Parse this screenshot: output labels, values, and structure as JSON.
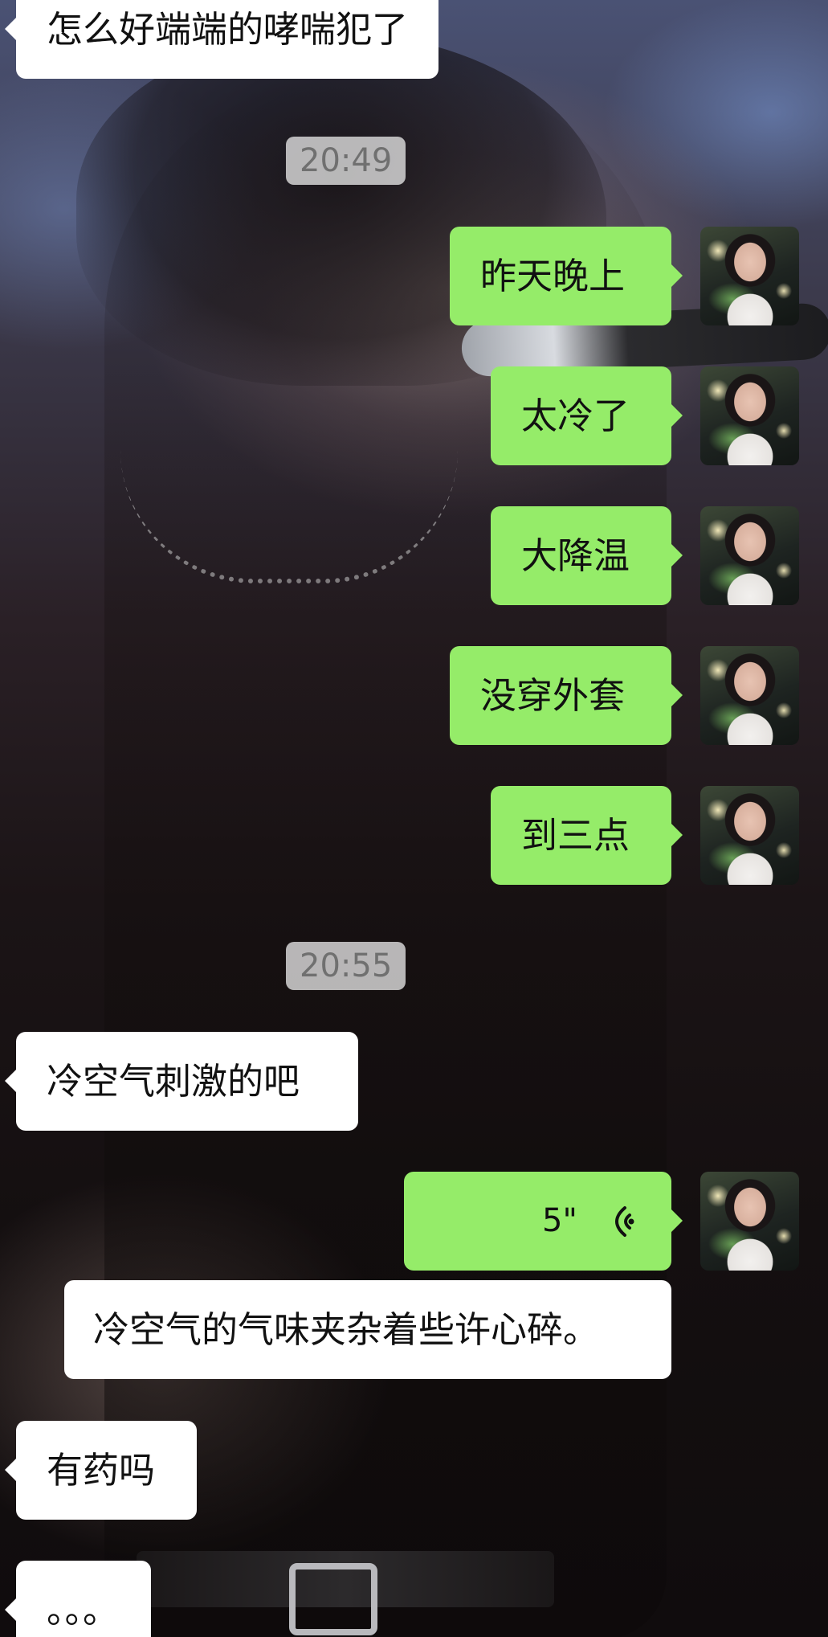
{
  "chat": {
    "timestamps": {
      "first": "20:49",
      "second": "20:55"
    },
    "messages": {
      "m1": "怎么好端端的哮喘犯了",
      "m2": "昨天晚上",
      "m3": "太冷了",
      "m4": "大降温",
      "m5": "没穿外套",
      "m6": "到三点",
      "m7": "冷空气刺激的吧",
      "m8_voice_duration": "5\"",
      "m9_transcript": "冷空气的气味夹杂着些许心碎。",
      "m10": "有药吗",
      "m11": "。。。"
    },
    "colors": {
      "outgoing_bubble": "#95ec69",
      "incoming_bubble": "#ffffff",
      "timestamp_bg": "#dcdcdc"
    },
    "icons": {
      "voice": "voice-wave-icon",
      "avatar": "user-avatar"
    }
  }
}
